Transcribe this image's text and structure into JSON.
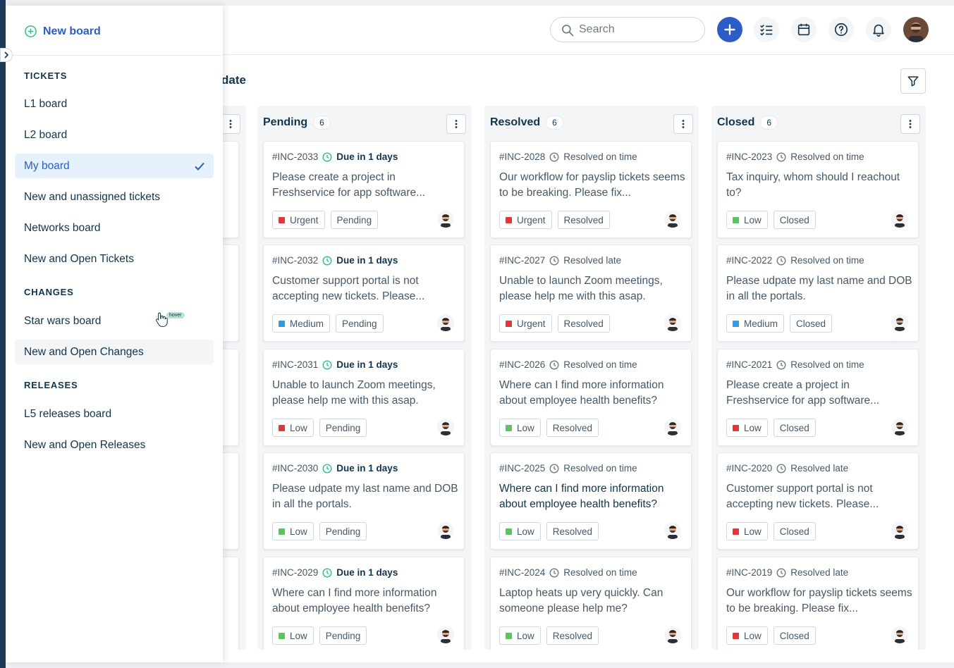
{
  "colors": {
    "accent": "#2c5cc5",
    "urgent": "#e43538",
    "medium": "#2c9ce8",
    "low": "#5cc45f",
    "due": "#2fbf8f"
  },
  "header": {
    "search_placeholder": "Search"
  },
  "subbar": {
    "text": "date"
  },
  "sidebar": {
    "new_board": "New board",
    "sections": [
      {
        "heading": "TICKETS",
        "items": [
          "L1 board",
          "L2 board",
          "My board",
          "New and unassigned tickets",
          "Networks board",
          "New and Open Tickets"
        ]
      },
      {
        "heading": "CHANGES",
        "items": [
          "Star wars board",
          "New and Open Changes"
        ]
      },
      {
        "heading": "RELEASES",
        "items": [
          "L5 releases board",
          "New and Open Releases"
        ]
      }
    ],
    "active_item": "My board",
    "hover_badge": "hover"
  },
  "columns": [
    {
      "title": "Pending",
      "count": "6",
      "cards": [
        {
          "id": "#INC-2033",
          "status_text": "Due in 1 days",
          "desc": "Please create a project in Freshservice for app software...",
          "priority": "Urgent",
          "priority_color": "#e43538",
          "state": "Pending"
        },
        {
          "id": "#INC-2032",
          "status_text": "Due in 1 days",
          "desc": "Customer support portal is not accepting new tickets. Please...",
          "priority": "Medium",
          "priority_color": "#2c9ce8",
          "state": "Pending"
        },
        {
          "id": "#INC-2031",
          "status_text": "Due in 1 days",
          "desc": "Unable to launch Zoom meetings, please help me with this asap.",
          "priority": "Low",
          "priority_color": "#e43538",
          "state": "Pending"
        },
        {
          "id": "#INC-2030",
          "status_text": "Due in 1 days",
          "desc": "Please udpate my last name and DOB in all the portals.",
          "priority": "Low",
          "priority_color": "#5cc45f",
          "state": "Pending"
        },
        {
          "id": "#INC-2029",
          "status_text": "Due in 1 days",
          "desc": "Where can I find more information about employee health benefits?",
          "priority": "Low",
          "priority_color": "#5cc45f",
          "state": "Pending"
        }
      ]
    },
    {
      "title": "Resolved",
      "count": "6",
      "cards": [
        {
          "id": "#INC-2028",
          "status_text": "Resolved on time",
          "desc": "Our workflow for payslip tickets seems to be breaking. Please fix...",
          "priority": "Urgent",
          "priority_color": "#e43538",
          "state": "Resolved"
        },
        {
          "id": "#INC-2027",
          "status_text": "Resolved late",
          "desc": "Unable to launch Zoom meetings, please help me with this asap.",
          "priority": "Urgent",
          "priority_color": "#e43538",
          "state": "Resolved"
        },
        {
          "id": "#INC-2026",
          "status_text": "Resolved on time",
          "desc": "Where can I find more information about employee health benefits?",
          "priority": "Low",
          "priority_color": "#5cc45f",
          "state": "Resolved"
        },
        {
          "id": "#INC-2025",
          "status_text": "Resolved on time",
          "desc": "Where can I find more information about employee health benefits?",
          "priority": "Low",
          "priority_color": "#5cc45f",
          "state": "Resolved"
        },
        {
          "id": "#INC-2024",
          "status_text": "Resolved on time",
          "desc": "Laptop heats up very quickly. Can someone please help me?",
          "priority": "Low",
          "priority_color": "#5cc45f",
          "state": "Resolved"
        }
      ]
    },
    {
      "title": "Closed",
      "count": "6",
      "cards": [
        {
          "id": "#INC-2023",
          "status_text": "Resolved on time",
          "desc": "Tax inquiry, whom should I reachout to?",
          "priority": "Low",
          "priority_color": "#5cc45f",
          "state": "Closed"
        },
        {
          "id": "#INC-2022",
          "status_text": "Resolved on time",
          "desc": "Please udpate my last name and DOB in all the portals.",
          "priority": "Medium",
          "priority_color": "#2c9ce8",
          "state": "Closed"
        },
        {
          "id": "#INC-2021",
          "status_text": "Resolved on time",
          "desc": "Please create a project in Freshservice for app software...",
          "priority": "Low",
          "priority_color": "#e43538",
          "state": "Closed"
        },
        {
          "id": "#INC-2020",
          "status_text": "Resolved late",
          "desc": "Customer support portal is not accepting new tickets. Please...",
          "priority": "Low",
          "priority_color": "#e43538",
          "state": "Closed"
        },
        {
          "id": "#INC-2019",
          "status_text": "Resolved late",
          "desc": "Our workflow for payslip tickets seems to be breaking. Please fix...",
          "priority": "Low",
          "priority_color": "#e43538",
          "state": "Closed"
        }
      ]
    }
  ]
}
